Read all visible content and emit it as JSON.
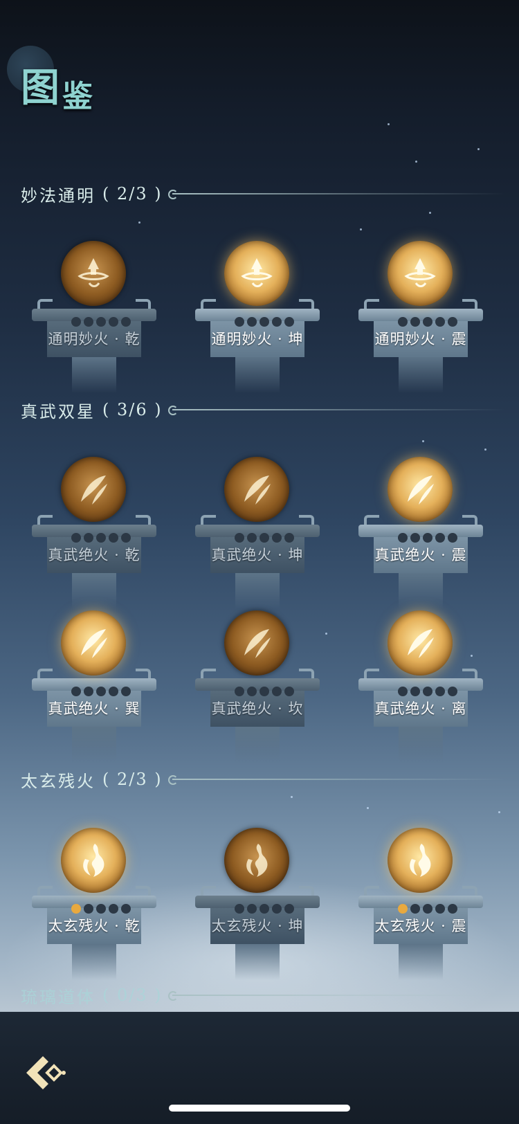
{
  "page": {
    "title": "图鉴",
    "title_part1": "图",
    "title_part2": "鉴"
  },
  "colors": {
    "accent": "#8fd3d0",
    "gold": "#e4b05a",
    "pip_lit": "#e8a93f"
  },
  "sections": [
    {
      "name": "妙法通明",
      "count": "( 2/3 )",
      "items": [
        {
          "label": "通明妙火 · 乾",
          "icon": "lotus-flame-icon",
          "unlocked": false,
          "pips_lit": 0
        },
        {
          "label": "通明妙火 · 坤",
          "icon": "lotus-flame-icon",
          "unlocked": true,
          "pips_lit": 0
        },
        {
          "label": "通明妙火 · 震",
          "icon": "lotus-flame-icon",
          "unlocked": true,
          "pips_lit": 0
        }
      ]
    },
    {
      "name": "真武双星",
      "count": "( 3/6 )",
      "items": [
        {
          "label": "真武绝火 · 乾",
          "icon": "blade-flame-icon",
          "unlocked": false,
          "pips_lit": 0
        },
        {
          "label": "真武绝火 · 坤",
          "icon": "blade-flame-icon",
          "unlocked": false,
          "pips_lit": 0
        },
        {
          "label": "真武绝火 · 震",
          "icon": "blade-flame-icon",
          "unlocked": true,
          "pips_lit": 0
        },
        {
          "label": "真武绝火 · 巽",
          "icon": "blade-flame-icon",
          "unlocked": true,
          "pips_lit": 0
        },
        {
          "label": "真武绝火 · 坎",
          "icon": "blade-flame-icon",
          "unlocked": false,
          "pips_lit": 0
        },
        {
          "label": "真武绝火 · 离",
          "icon": "blade-flame-icon",
          "unlocked": true,
          "pips_lit": 0
        }
      ]
    },
    {
      "name": "太玄残火",
      "count": "( 2/3 )",
      "items": [
        {
          "label": "太玄残火 · 乾",
          "icon": "wisp-flame-icon",
          "unlocked": true,
          "pips_lit": 1
        },
        {
          "label": "太玄残火 · 坤",
          "icon": "wisp-flame-icon",
          "unlocked": false,
          "pips_lit": 0
        },
        {
          "label": "太玄残火 · 震",
          "icon": "wisp-flame-icon",
          "unlocked": true,
          "pips_lit": 1
        }
      ]
    },
    {
      "name": "琉璃道体",
      "count": "( 0/3 )",
      "items": []
    }
  ],
  "nav": {
    "back_icon": "back-arrow-icon"
  }
}
